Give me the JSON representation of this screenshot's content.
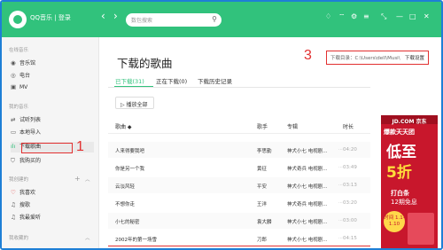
{
  "app": {
    "title": "QQ音乐 | 登录"
  },
  "search": {
    "placeholder": "数包搜索"
  },
  "sidebar": {
    "sec_online": "在线音乐",
    "online": [
      "音乐馆",
      "电台",
      "MV"
    ],
    "sec_mine": "我的音乐",
    "mine": [
      "试听列表",
      "本地导入",
      "下载歌曲",
      "我购买的"
    ],
    "sec_created": "我创建的",
    "created": [
      "我喜欢",
      "搜歌",
      "我最爱听"
    ],
    "sec_collected": "我收藏的"
  },
  "main": {
    "title": "下载的歌曲",
    "tabs": [
      "已下载(31)",
      "正在下载(0)",
      "下载历史记录"
    ],
    "play_all": "▷ 播放全部",
    "dir_label": "下载目录：C:\\Users\\dell\\Musi\\",
    "dir_setting": "下载设置",
    "columns": [
      "歌曲 ◆",
      "歌手",
      "专辑",
      "时长"
    ],
    "songs": [
      {
        "title": "人来得要我吧",
        "artist": "李思勤",
        "album": "神犬小七 电视剧...",
        "time": "04:20"
      },
      {
        "title": "你是另一个我",
        "artist": "黄征",
        "album": "神犬奇兵 电视剧...",
        "time": "03:49"
      },
      {
        "title": "云淡风轻",
        "artist": "平安",
        "album": "神犬小七 电视剧...",
        "time": "03:13"
      },
      {
        "title": "不想你走",
        "artist": "王洋",
        "album": "神犬奇兵 电视剧...",
        "time": "03:20"
      },
      {
        "title": "小七的秘密",
        "artist": "袁大麟",
        "album": "神犬小七 电视剧...",
        "time": "03:00"
      },
      {
        "title": "2002年的第一场雪",
        "artist": "刀郎",
        "album": "神犬小七 电视剧...",
        "time": "04:15"
      }
    ]
  },
  "annotations": {
    "n1": "1",
    "n3": "3"
  },
  "ad": {
    "brand": "JD.COM 京东",
    "line1": "爆款天天团",
    "big1": "低至",
    "big2": "5折",
    "line2": "打白条",
    "line3": "12期免息",
    "badge": "时间 1.1-1.10"
  }
}
